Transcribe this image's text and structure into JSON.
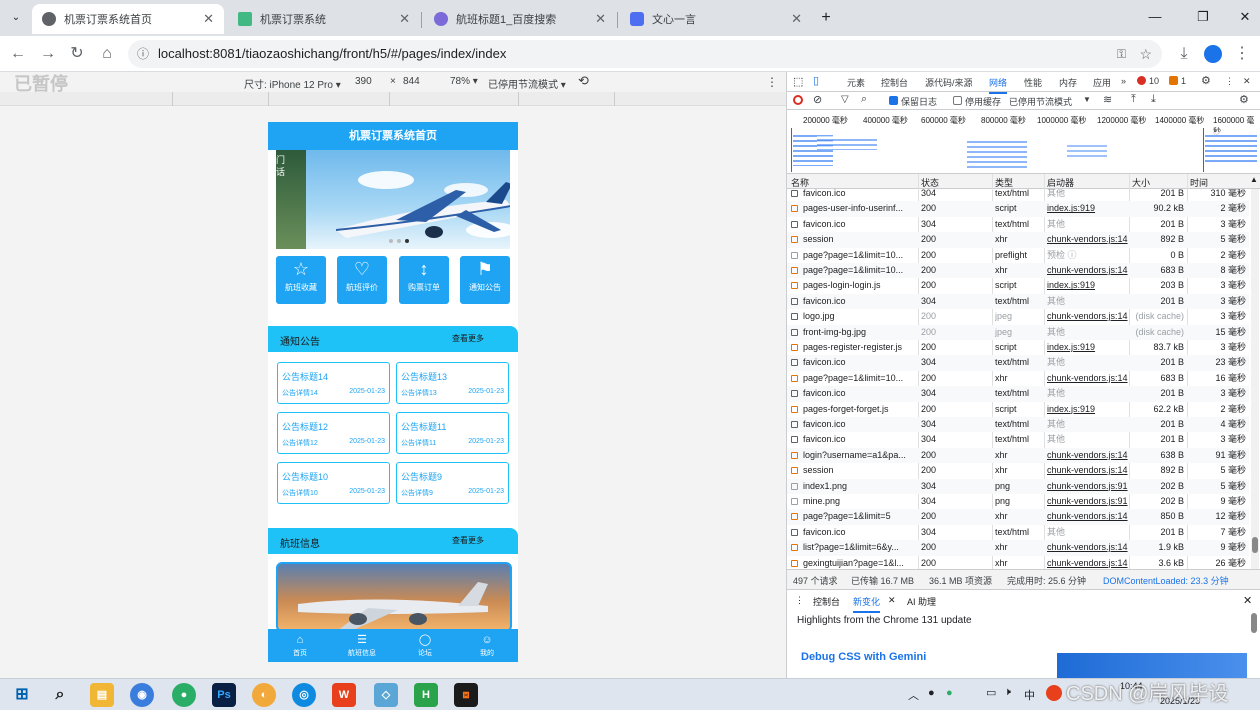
{
  "browser": {
    "tabs": [
      {
        "title": "机票订票系统首页",
        "active": true
      },
      {
        "title": "机票订票系统",
        "active": false
      },
      {
        "title": "航班标题1_百度搜索",
        "active": false
      },
      {
        "title": "文心一言",
        "active": false
      }
    ],
    "url": "localhost:8081/tiaozaoshichang/front/h5/#/pages/index/index"
  },
  "device_toolbar": {
    "watermark": "已暂停",
    "size_label": "尺寸: iPhone 12 Pro ▾",
    "width": "390",
    "times": "×",
    "height": "844",
    "zoom": "78% ▾",
    "throttle": "已停用节流模式 ▾"
  },
  "phone": {
    "header_title": "机票订票系统首页",
    "banner_text": "门\n话",
    "features": [
      {
        "label": "航班收藏",
        "icon": "☆"
      },
      {
        "label": "航班评价",
        "icon": "♡"
      },
      {
        "label": "购票订单",
        "icon": "↕"
      },
      {
        "label": "通知公告",
        "icon": "⚑"
      }
    ],
    "notice_section": {
      "title": "通知公告",
      "more": "查看更多"
    },
    "notices": [
      {
        "title": "公告标题14",
        "detail": "公告详情14",
        "date": "2025-01-23"
      },
      {
        "title": "公告标题13",
        "detail": "公告详情13",
        "date": "2025-01-23"
      },
      {
        "title": "公告标题12",
        "detail": "公告详情12",
        "date": "2025-01-23"
      },
      {
        "title": "公告标题11",
        "detail": "公告详情11",
        "date": "2025-01-23"
      },
      {
        "title": "公告标题10",
        "detail": "公告详情10",
        "date": "2025-01-23"
      },
      {
        "title": "公告标题9",
        "detail": "公告详情9",
        "date": "2025-01-23"
      }
    ],
    "flight_section": {
      "title": "航班信息",
      "more": "查看更多"
    },
    "tabbar": [
      {
        "label": "首页",
        "icon": "⌂"
      },
      {
        "label": "航班信息",
        "icon": "☰"
      },
      {
        "label": "论坛",
        "icon": "◯"
      },
      {
        "label": "我的",
        "icon": "☺"
      }
    ]
  },
  "devtools": {
    "tabs": [
      "元素",
      "控制台",
      "源代码/来源",
      "网络",
      "性能",
      "内存",
      "应用"
    ],
    "active_tab": "网络",
    "errors": "10",
    "warnings": "1",
    "filter": {
      "preserve_log": "保留日志",
      "disable_cache": "停用缓存",
      "throttle": "已停用节流模式"
    },
    "timeline_ticks": [
      "200000 毫秒",
      "400000 毫秒",
      "600000 毫秒",
      "800000 毫秒",
      "1000000 毫秒",
      "1200000 毫秒",
      "1400000 毫秒",
      "1600000 毫秒"
    ],
    "columns": [
      "名称",
      "状态",
      "类型",
      "启动器",
      "大小",
      "时间"
    ],
    "rows": [
      {
        "name": "favicon.ico",
        "status": "304",
        "type": "text/html",
        "initiator": "其他",
        "size": "201 B",
        "time": "310 毫秒"
      },
      {
        "name": "pages-user-info-userinf...",
        "status": "200",
        "type": "script",
        "initiator": "index.js:919",
        "size": "90.2 kB",
        "time": "2 毫秒"
      },
      {
        "name": "favicon.ico",
        "status": "304",
        "type": "text/html",
        "initiator": "其他",
        "size": "201 B",
        "time": "3 毫秒"
      },
      {
        "name": "session",
        "status": "200",
        "type": "xhr",
        "initiator": "chunk-vendors.js:14",
        "size": "892 B",
        "time": "5 毫秒"
      },
      {
        "name": "page?page=1&limit=10...",
        "status": "200",
        "type": "preflight",
        "initiator": "预检 ⓘ",
        "size": "0 B",
        "time": "2 毫秒"
      },
      {
        "name": "page?page=1&limit=10...",
        "status": "200",
        "type": "xhr",
        "initiator": "chunk-vendors.js:14",
        "size": "683 B",
        "time": "8 毫秒"
      },
      {
        "name": "pages-login-login.js",
        "status": "200",
        "type": "script",
        "initiator": "index.js:919",
        "size": "203 B",
        "time": "3 毫秒"
      },
      {
        "name": "favicon.ico",
        "status": "304",
        "type": "text/html",
        "initiator": "其他",
        "size": "201 B",
        "time": "3 毫秒"
      },
      {
        "name": "logo.jpg",
        "status": "200",
        "type": "jpeg",
        "initiator": "chunk-vendors.js:14",
        "size": "(disk cache)",
        "time": "3 毫秒"
      },
      {
        "name": "front-img-bg.jpg",
        "status": "200",
        "type": "jpeg",
        "initiator": "其他",
        "size": "(disk cache)",
        "time": "15 毫秒"
      },
      {
        "name": "pages-register-register.js",
        "status": "200",
        "type": "script",
        "initiator": "index.js:919",
        "size": "83.7 kB",
        "time": "3 毫秒"
      },
      {
        "name": "favicon.ico",
        "status": "304",
        "type": "text/html",
        "initiator": "其他",
        "size": "201 B",
        "time": "23 毫秒"
      },
      {
        "name": "page?page=1&limit=10...",
        "status": "200",
        "type": "xhr",
        "initiator": "chunk-vendors.js:14",
        "size": "683 B",
        "time": "16 毫秒"
      },
      {
        "name": "favicon.ico",
        "status": "304",
        "type": "text/html",
        "initiator": "其他",
        "size": "201 B",
        "time": "3 毫秒"
      },
      {
        "name": "pages-forget-forget.js",
        "status": "200",
        "type": "script",
        "initiator": "index.js:919",
        "size": "62.2 kB",
        "time": "2 毫秒"
      },
      {
        "name": "favicon.ico",
        "status": "304",
        "type": "text/html",
        "initiator": "其他",
        "size": "201 B",
        "time": "4 毫秒"
      },
      {
        "name": "favicon.ico",
        "status": "304",
        "type": "text/html",
        "initiator": "其他",
        "size": "201 B",
        "time": "3 毫秒"
      },
      {
        "name": "login?username=a1&pa...",
        "status": "200",
        "type": "xhr",
        "initiator": "chunk-vendors.js:14",
        "size": "638 B",
        "time": "91 毫秒"
      },
      {
        "name": "session",
        "status": "200",
        "type": "xhr",
        "initiator": "chunk-vendors.js:14",
        "size": "892 B",
        "time": "5 毫秒"
      },
      {
        "name": "index1.png",
        "status": "304",
        "type": "png",
        "initiator": "chunk-vendors.js:91",
        "size": "202 B",
        "time": "5 毫秒"
      },
      {
        "name": "mine.png",
        "status": "304",
        "type": "png",
        "initiator": "chunk-vendors.js:91",
        "size": "202 B",
        "time": "9 毫秒"
      },
      {
        "name": "page?page=1&limit=5",
        "status": "200",
        "type": "xhr",
        "initiator": "chunk-vendors.js:14",
        "size": "850 B",
        "time": "12 毫秒"
      },
      {
        "name": "favicon.ico",
        "status": "304",
        "type": "text/html",
        "initiator": "其他",
        "size": "201 B",
        "time": "7 毫秒"
      },
      {
        "name": "list?page=1&limit=6&y...",
        "status": "200",
        "type": "xhr",
        "initiator": "chunk-vendors.js:14",
        "size": "1.9 kB",
        "time": "9 毫秒"
      },
      {
        "name": "gexingtuijian?page=1&l...",
        "status": "200",
        "type": "xhr",
        "initiator": "chunk-vendors.js:14",
        "size": "3.6 kB",
        "time": "26 毫秒"
      }
    ],
    "summary": {
      "requests": "497 个请求",
      "transferred": "已传输 16.7 MB",
      "resources": "36.1 MB 项资源",
      "finish": "完成用时: 25.6 分钟",
      "dcl": "DOMContentLoaded: 23.3 分钟"
    },
    "drawer_tabs": [
      "控制台",
      "新变化",
      "AI 助理"
    ],
    "drawer_active": "新变化",
    "drawer_highlight": "Highlights from the Chrome 131 update",
    "drawer_link": "Debug CSS with Gemini"
  },
  "taskbar": {
    "apps": [
      "⊞",
      "⌕",
      "▤",
      "◉",
      "●",
      "Ps",
      "◐",
      "◎",
      "W",
      "◇",
      "H",
      "⧈"
    ],
    "ime": "中",
    "time": "10:44",
    "date": "2025/1/23",
    "watermark": "CSDN @岸风毕设"
  },
  "colors": {
    "accent": "#1ea4f3",
    "section": "#1ec2f7",
    "error": "#d93025",
    "link": "#1a73e8"
  }
}
